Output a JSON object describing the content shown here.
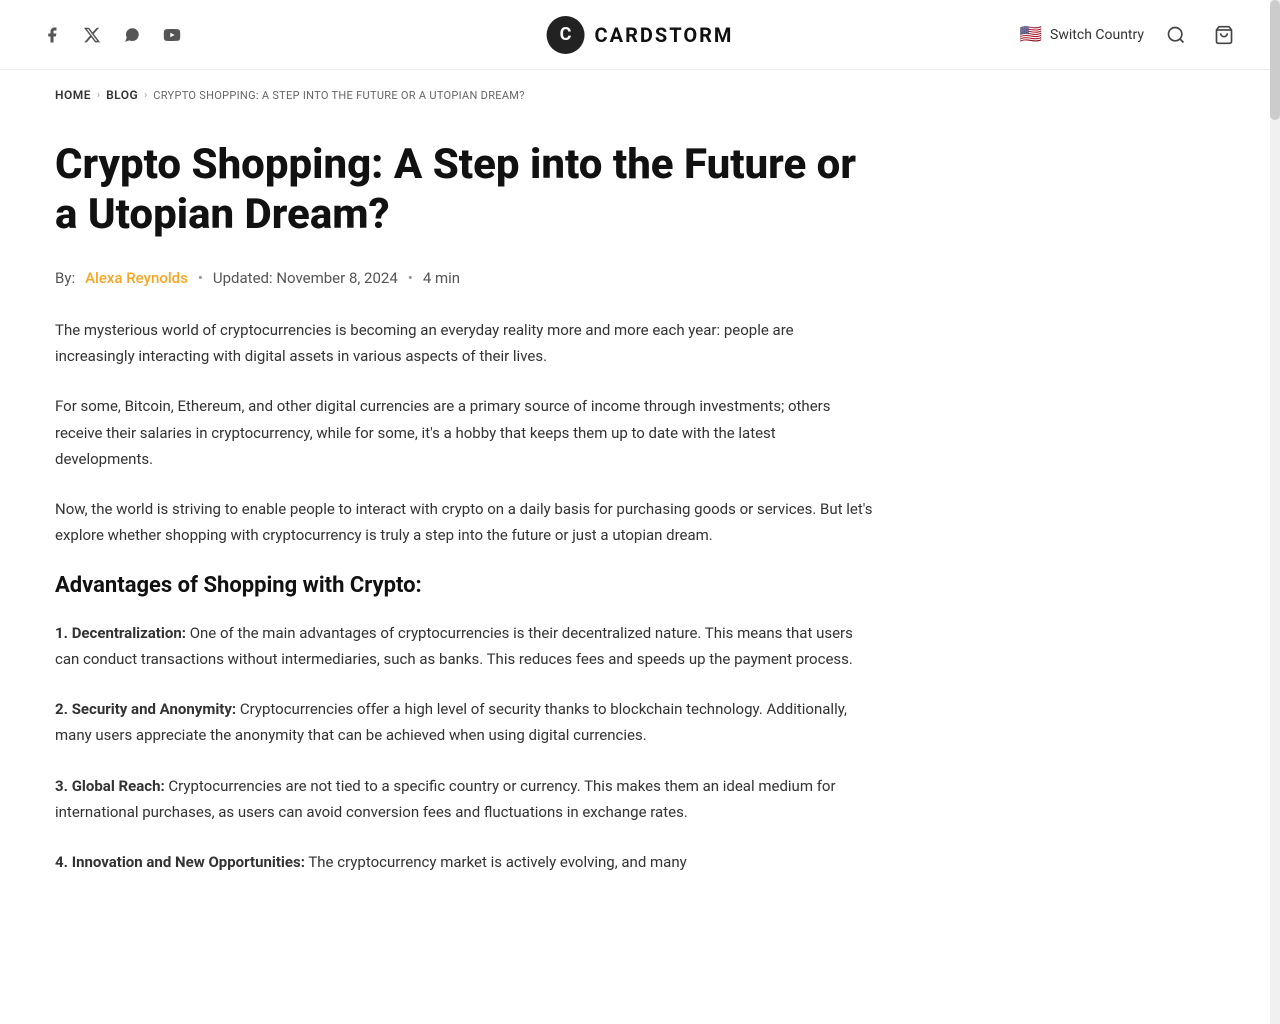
{
  "header": {
    "logo_letter": "C",
    "logo_name": "CARDSTORM",
    "social_icons": [
      {
        "name": "facebook",
        "symbol": "f"
      },
      {
        "name": "twitter-x",
        "symbol": "✕"
      },
      {
        "name": "whatsapp",
        "symbol": "⊕"
      },
      {
        "name": "youtube",
        "symbol": "▶"
      }
    ],
    "switch_country_label": "Switch Country",
    "flag_emoji": "🇺🇸"
  },
  "breadcrumb": {
    "home": "HOME",
    "blog": "BLOG",
    "current": "CRYPTO SHOPPING: A STEP INTO THE FUTURE OR A UTOPIAN DREAM?"
  },
  "article": {
    "title": "Crypto Shopping: A Step into the Future or a Utopian Dream?",
    "author_prefix": "By:",
    "author_name": "Alexa Reynolds",
    "updated_label": "Updated: November 8, 2024",
    "read_time": "4 min",
    "intro_p1": "The mysterious world of cryptocurrencies is becoming an everyday reality more and more each year: people are increasingly interacting with digital assets in various aspects of their lives.",
    "intro_p2": "For some, Bitcoin, Ethereum, and other digital currencies are a primary source of income through investments; others receive their salaries in cryptocurrency, while for some, it's a hobby that keeps them up to date with the latest developments.",
    "intro_p3": "Now, the world is striving to enable people to interact with crypto on a daily basis for purchasing goods or services. But let's explore whether shopping with cryptocurrency is truly a step into the future or just a utopian dream.",
    "advantages_heading": "Advantages of Shopping with Crypto:",
    "advantages": [
      {
        "number": "1.",
        "label": "Decentralization:",
        "text": " One of the main advantages of cryptocurrencies is their decentralized nature. This means that users can conduct transactions without intermediaries, such as banks. This reduces fees and speeds up the payment process."
      },
      {
        "number": "2.",
        "label": "Security and Anonymity:",
        "text": " Cryptocurrencies offer a high level of security thanks to blockchain technology. Additionally, many users appreciate the anonymity that can be achieved when using digital currencies."
      },
      {
        "number": "3.",
        "label": "Global Reach:",
        "text": " Cryptocurrencies are not tied to a specific country or currency. This makes them an ideal medium for international purchases, as users can avoid conversion fees and fluctuations in exchange rates."
      },
      {
        "number": "4.",
        "label": "Innovation and New Opportunities:",
        "text": " The cryptocurrency market is actively evolving, and many"
      }
    ]
  },
  "colors": {
    "accent_orange": "#f5a623",
    "text_dark": "#111111",
    "text_body": "#333333",
    "text_muted": "#666666",
    "border_light": "#eeeeee"
  }
}
